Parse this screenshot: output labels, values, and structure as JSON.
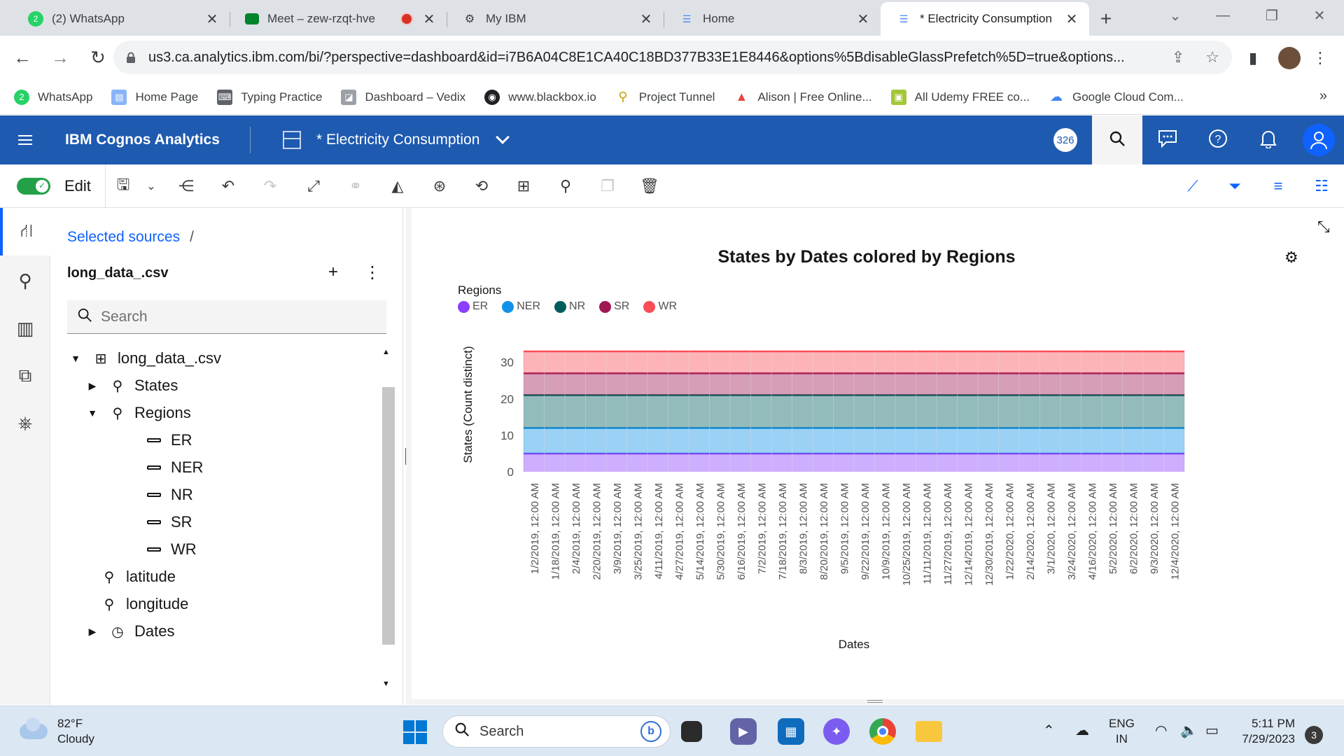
{
  "browser": {
    "tabs": [
      {
        "title": "(2) WhatsApp",
        "icon": "whatsapp-icon"
      },
      {
        "title": "Meet – zew-rzqt-hve",
        "icon": "meet-icon",
        "recording": true
      },
      {
        "title": "My IBM",
        "icon": "ibm-icon"
      },
      {
        "title": "Home",
        "icon": "cognos-icon"
      },
      {
        "title": "* Electricity Consumption",
        "icon": "cognos-icon",
        "active": true
      }
    ],
    "new_tab": "+",
    "url": "us3.ca.analytics.ibm.com/bi/?perspective=dashboard&id=i7B6A04C8E1CA40C18BD377B33E1E8446&options%5BdisableGlassPrefetch%5D=true&options...",
    "bookmarks": [
      {
        "label": "WhatsApp",
        "icon": "whatsapp-icon",
        "color": "#25d366"
      },
      {
        "label": "Home Page",
        "icon": "page-icon",
        "color": "#8ab4f8"
      },
      {
        "label": "Typing Practice",
        "icon": "keyboard-icon",
        "color": "#5f6368"
      },
      {
        "label": "Dashboard – Vedix",
        "icon": "vedix-icon",
        "color": "#9aa0a6"
      },
      {
        "label": "www.blackbox.io",
        "icon": "blackbox-icon",
        "color": "#202124"
      },
      {
        "label": "Project Tunnel",
        "icon": "bulb-icon",
        "color": "#c4a000"
      },
      {
        "label": "Alison | Free Online...",
        "icon": "alison-icon",
        "color": "#e8453c"
      },
      {
        "label": "All Udemy FREE co...",
        "icon": "udemy-icon",
        "color": "#a4c639"
      },
      {
        "label": "Google Cloud Com...",
        "icon": "gcloud-icon",
        "color": "#4285f4"
      }
    ],
    "more_bookmarks": "»"
  },
  "app": {
    "brand": "IBM Cognos Analytics",
    "document_title": "* Electricity Consumption",
    "counter": "326",
    "edit_label": "Edit"
  },
  "panel": {
    "breadcrumb": "Selected sources",
    "breadcrumb_sep": "/",
    "source_name": "long_data_.csv",
    "search_placeholder": "Search",
    "tree": [
      {
        "label": "long_data_.csv",
        "kind": "table",
        "twisty": "▼",
        "level": 0
      },
      {
        "label": "States",
        "kind": "geo",
        "twisty": "▶",
        "level": 1
      },
      {
        "label": "Regions",
        "kind": "geo",
        "twisty": "▼",
        "level": 1
      },
      {
        "label": "ER",
        "kind": "member",
        "level": 2
      },
      {
        "label": "NER",
        "kind": "member",
        "level": 2
      },
      {
        "label": "NR",
        "kind": "member",
        "level": 2
      },
      {
        "label": "SR",
        "kind": "member",
        "level": 2
      },
      {
        "label": "WR",
        "kind": "member",
        "level": 2
      },
      {
        "label": "latitude",
        "kind": "geo",
        "level": 1,
        "leaf": true
      },
      {
        "label": "longitude",
        "kind": "geo",
        "level": 1,
        "leaf": true
      },
      {
        "label": "Dates",
        "kind": "time",
        "twisty": "▶",
        "level": 1
      }
    ]
  },
  "colors": {
    "ER": "#8a3ffc",
    "NER": "#1192e8",
    "NR": "#005d5d",
    "SR": "#9f1853",
    "WR": "#fa4d56"
  },
  "chart_data": {
    "type": "area",
    "stacked": true,
    "title": "States by Dates colored by Regions",
    "xlabel": "Dates",
    "ylabel": "States (Count distinct)",
    "legend_title": "Regions",
    "legend_position": "top-left",
    "ylim": [
      0,
      33
    ],
    "yticks": [
      0,
      10,
      20,
      30
    ],
    "categories": [
      "1/2/2019, 12:00 AM",
      "1/18/2019, 12:00 AM",
      "2/4/2019, 12:00 AM",
      "2/20/2019, 12:00 AM",
      "3/9/2019, 12:00 AM",
      "3/25/2019, 12:00 AM",
      "4/11/2019, 12:00 AM",
      "4/27/2019, 12:00 AM",
      "5/14/2019, 12:00 AM",
      "5/30/2019, 12:00 AM",
      "6/16/2019, 12:00 AM",
      "7/2/2019, 12:00 AM",
      "7/18/2019, 12:00 AM",
      "8/3/2019, 12:00 AM",
      "8/20/2019, 12:00 AM",
      "9/5/2019, 12:00 AM",
      "9/22/2019, 12:00 AM",
      "10/9/2019, 12:00 AM",
      "10/25/2019, 12:00 AM",
      "11/11/2019, 12:00 AM",
      "11/27/2019, 12:00 AM",
      "12/14/2019, 12:00 AM",
      "12/30/2019, 12:00 AM",
      "1/22/2020, 12:00 AM",
      "2/14/2020, 12:00 AM",
      "3/1/2020, 12:00 AM",
      "3/24/2020, 12:00 AM",
      "4/16/2020, 12:00 AM",
      "5/2/2020, 12:00 AM",
      "6/2/2020, 12:00 AM",
      "9/3/2020, 12:00 AM",
      "12/4/2020, 12:00 AM"
    ],
    "series": [
      {
        "name": "ER",
        "value": 5
      },
      {
        "name": "NER",
        "value": 7
      },
      {
        "name": "NR",
        "value": 9
      },
      {
        "name": "SR",
        "value": 6
      },
      {
        "name": "WR",
        "value": 6
      }
    ]
  },
  "taskbar": {
    "temperature": "82°F",
    "condition": "Cloudy",
    "search_placeholder": "Search",
    "lang_1": "ENG",
    "lang_2": "IN",
    "time": "5:11 PM",
    "date": "7/29/2023",
    "notifications": "3"
  }
}
